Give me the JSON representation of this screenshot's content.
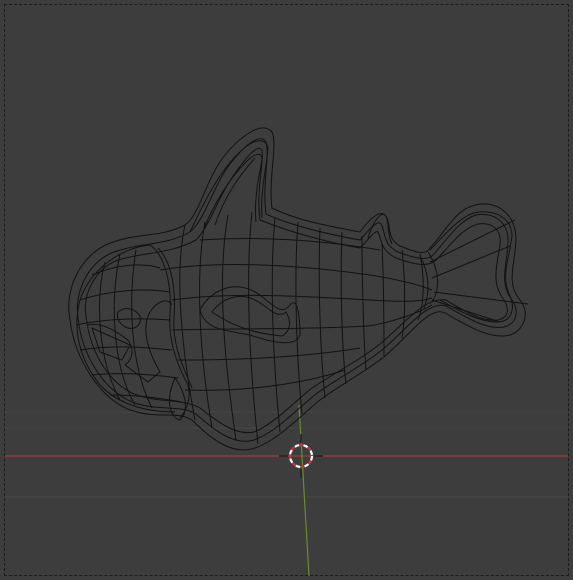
{
  "viewport": {
    "name": "3D Viewport",
    "shading": "wireframe",
    "background_color": "#3d3d3d",
    "grid_color": "#474747",
    "axis_x_color": "#a1383f",
    "axis_y_color": "#6b8a2e",
    "wire_color": "#121212",
    "cursor_colors": [
      "#ffffff",
      "#d0303a"
    ]
  },
  "object": {
    "type": "mesh",
    "subject": "fish"
  }
}
